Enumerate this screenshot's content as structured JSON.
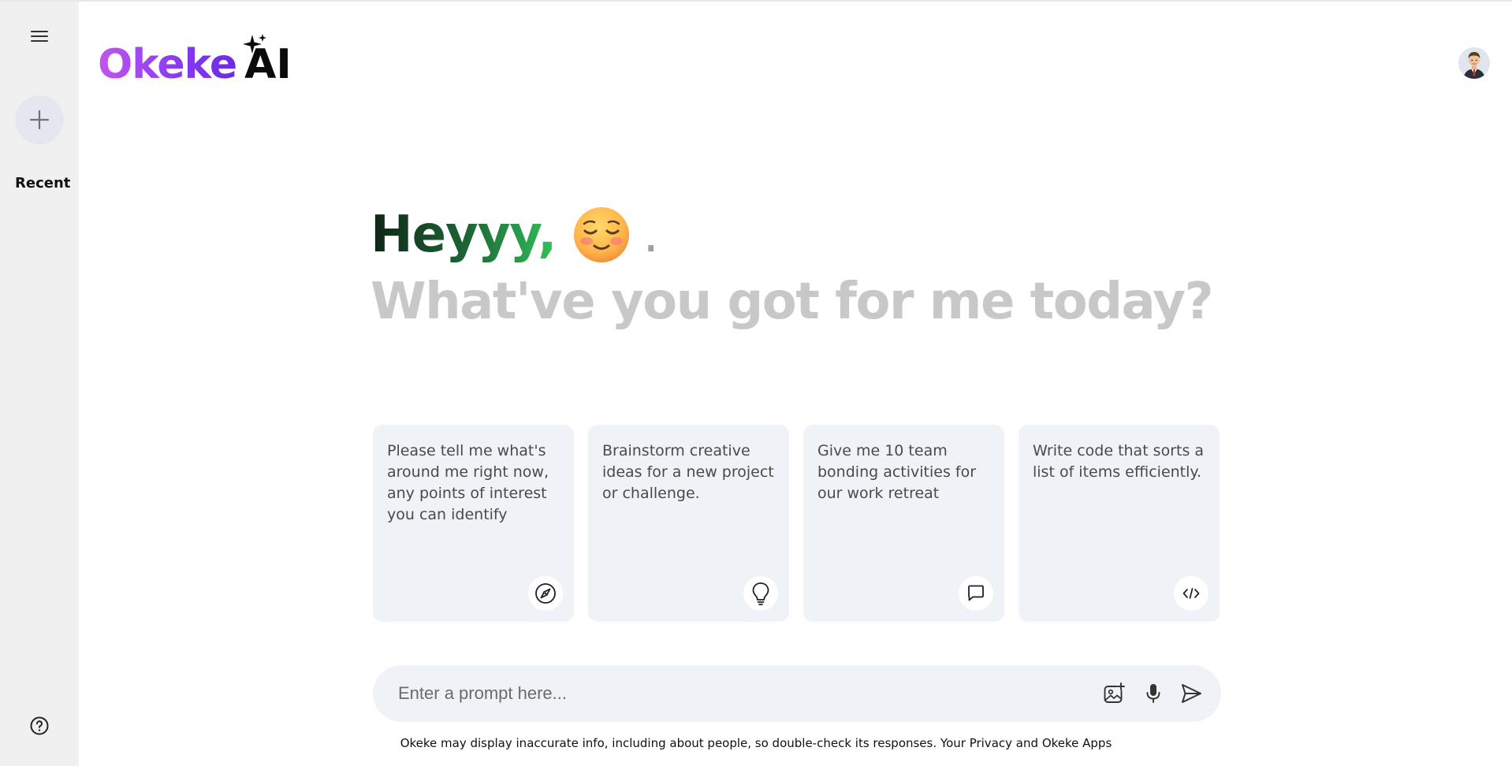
{
  "sidebar": {
    "menu_icon": "hamburger-menu-icon",
    "new_chat_icon": "plus-icon",
    "recent_label": "Recent",
    "help_icon": "question-circle-icon"
  },
  "header": {
    "logo_text": "Okeke",
    "logo_ai": "AI",
    "logo_sparkles_icon": "sparkles-icon",
    "avatar_icon": "user-avatar"
  },
  "hero": {
    "greeting": "Heyyy,",
    "emoji": "relieved-face-emoji",
    "trailing": ".",
    "subtitle": "What've you got for me today?"
  },
  "cards": [
    {
      "text": "Please tell me what's around me right now, any points of interest you can identify",
      "icon": "compass-icon"
    },
    {
      "text": "Brainstorm creative ideas for a new project or challenge.",
      "icon": "lightbulb-icon"
    },
    {
      "text": "Give me 10 team bonding activities for our work retreat",
      "icon": "chat-bubble-icon"
    },
    {
      "text": "Write code that sorts a list of items efficiently.",
      "icon": "code-icon"
    }
  ],
  "prompt": {
    "placeholder": "Enter a prompt here...",
    "value": "",
    "image_icon": "add-image-icon",
    "mic_icon": "microphone-icon",
    "send_icon": "send-icon"
  },
  "footer": {
    "disclaimer": "Okeke may display inaccurate info, including about people, so double-check its responses.",
    "privacy_link": "Your Privacy",
    "and_text": "and",
    "apps_link": "Okeke Apps"
  },
  "colors": {
    "sidebar_bg": "#f0f0f1",
    "card_bg": "#eff2f6",
    "logo_gradient_start": "#c455f0",
    "logo_gradient_end": "#6a2be6",
    "greeting_gradient_start": "#0f2418",
    "greeting_gradient_end": "#34c25a",
    "subtitle": "#c8c8c8"
  }
}
